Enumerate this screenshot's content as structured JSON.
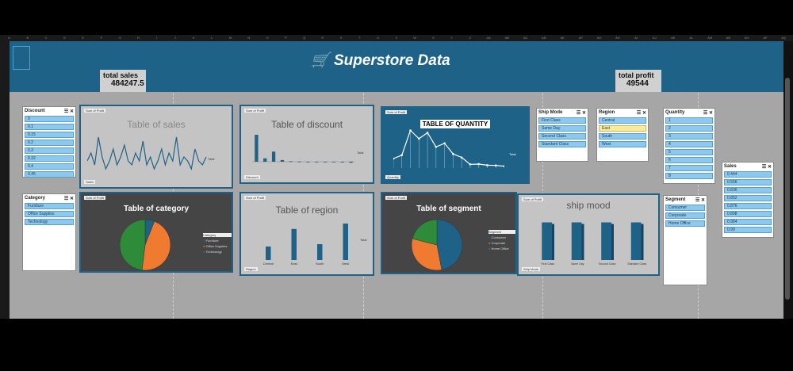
{
  "header": {
    "title": "Superstore Data",
    "cart_icon": "cart-icon"
  },
  "kpis": {
    "sales": {
      "label": "total sales",
      "value": "484247.5"
    },
    "profit": {
      "label": "total profit",
      "value": "49544"
    }
  },
  "columns": [
    "A",
    "B",
    "C",
    "D",
    "E",
    "F",
    "G",
    "H",
    "I",
    "J",
    "K",
    "L",
    "M",
    "N",
    "O",
    "P",
    "Q",
    "R",
    "S",
    "T",
    "U",
    "V",
    "W",
    "X",
    "Y",
    "Z",
    "AA",
    "AB",
    "AC",
    "AD",
    "AE",
    "AF",
    "AG",
    "AH",
    "AI",
    "AJ",
    "AK",
    "AL",
    "AM",
    "AN",
    "AO",
    "AP",
    "AQ"
  ],
  "slicers": {
    "discount": {
      "title": "Discount",
      "items": [
        "0",
        "0.1",
        "0.15",
        "0.2",
        "0.3",
        "0.32",
        "0.4",
        "0.45"
      ]
    },
    "category": {
      "title": "Category",
      "items": [
        "Furniture",
        "Office Supplies",
        "Technology"
      ]
    },
    "ship_mode": {
      "title": "Ship Mode",
      "items": [
        "First Class",
        "Same Day",
        "Second Class",
        "Standard Class"
      ]
    },
    "region": {
      "title": "Region",
      "items": [
        "Central",
        "East",
        "South",
        "West"
      ]
    },
    "quantity": {
      "title": "Quantity",
      "items": [
        "1",
        "2",
        "3",
        "4",
        "5",
        "6",
        "7",
        "8"
      ]
    },
    "segment": {
      "title": "Segment",
      "items": [
        "Consumer",
        "Corporate",
        "Home Office"
      ]
    },
    "sales": {
      "title": "Sales",
      "items": [
        "0.444",
        "0.556",
        "0.836",
        "0.852",
        "0.876",
        "0.898",
        "0.984",
        "0.99"
      ]
    }
  },
  "charts": {
    "sales": {
      "title": "Table of sales",
      "tag": "Sum of Profit",
      "legend": "Total",
      "filter": "Sales"
    },
    "discount": {
      "title": "Table of discount",
      "tag": "Sum of Profit",
      "legend": "Total",
      "filter": "Discount"
    },
    "quantity": {
      "title": "TABLE OF QUANTITY",
      "tag": "Sum of Profit",
      "legend": "Total",
      "filter": "Quantity"
    },
    "category": {
      "title": "Table of category",
      "tag": "Sum of Profit",
      "legend_title": "Category",
      "filter": ""
    },
    "region": {
      "title": "Table of region",
      "tag": "Sum of Profit",
      "legend": "Total",
      "filter": "Region"
    },
    "segment": {
      "title": "Table of segment",
      "tag": "Sum of Profit",
      "legend_title": "Segment"
    },
    "ship": {
      "title": "ship mood",
      "tag": "Sum of Profit",
      "filter": "Ship Mode"
    }
  },
  "chart_data": [
    {
      "type": "line",
      "title": "Table of sales",
      "series": [
        {
          "name": "Total",
          "values": [
            3,
            5,
            2,
            9,
            4,
            1,
            3,
            6,
            2,
            4,
            7,
            3,
            2,
            5,
            3,
            8,
            2,
            4,
            1,
            3,
            6,
            2,
            5,
            3,
            9,
            2,
            4,
            3,
            1,
            6,
            3,
            2,
            4
          ]
        }
      ]
    },
    {
      "type": "bar",
      "title": "Table of discount",
      "categories": [
        "0",
        "0.1",
        "0.15",
        "0.2",
        "0.3",
        "0.32",
        "0.4",
        "0.45",
        "0.5",
        "0.6",
        "0.7",
        "0.8"
      ],
      "values": [
        320000,
        40000,
        120000,
        20000,
        5000,
        3000,
        -4000,
        -2000,
        -3000,
        -5000,
        -8000,
        -12000
      ]
    },
    {
      "type": "line",
      "title": "TABLE OF QUANTITY",
      "categories": [
        "1",
        "2",
        "3",
        "4",
        "5",
        "6",
        "7",
        "8",
        "9",
        "10",
        "11",
        "12",
        "13",
        "14"
      ],
      "values": [
        4000,
        5500,
        16000,
        12500,
        15000,
        9000,
        10500,
        6000,
        4500,
        1600,
        1700,
        1200,
        1100,
        800
      ]
    },
    {
      "type": "pie",
      "title": "Table of category",
      "categories": [
        "Furniture",
        "Office Supplies",
        "Technology"
      ],
      "values": [
        6,
        46,
        48
      ],
      "labels": [
        "Furniture 6%",
        "Office Supplies 46%",
        "Technology 51%"
      ]
    },
    {
      "type": "bar",
      "title": "Table of region",
      "categories": [
        "Central",
        "East",
        "South",
        "West"
      ],
      "values": [
        40000,
        92000,
        47000,
        108000
      ]
    },
    {
      "type": "pie",
      "title": "Table of segment",
      "categories": [
        "Consumer",
        "Corporate",
        "Home Office"
      ],
      "values": [
        47,
        32,
        21
      ],
      "labels": [
        "Consumer 47%",
        "Corporate 33%",
        "Home Office 21%"
      ]
    },
    {
      "type": "bar",
      "title": "ship mood",
      "categories": [
        "First Class",
        "Same Day",
        "Second Class",
        "Standard Class"
      ],
      "values": [
        95,
        95,
        95,
        95
      ]
    }
  ]
}
